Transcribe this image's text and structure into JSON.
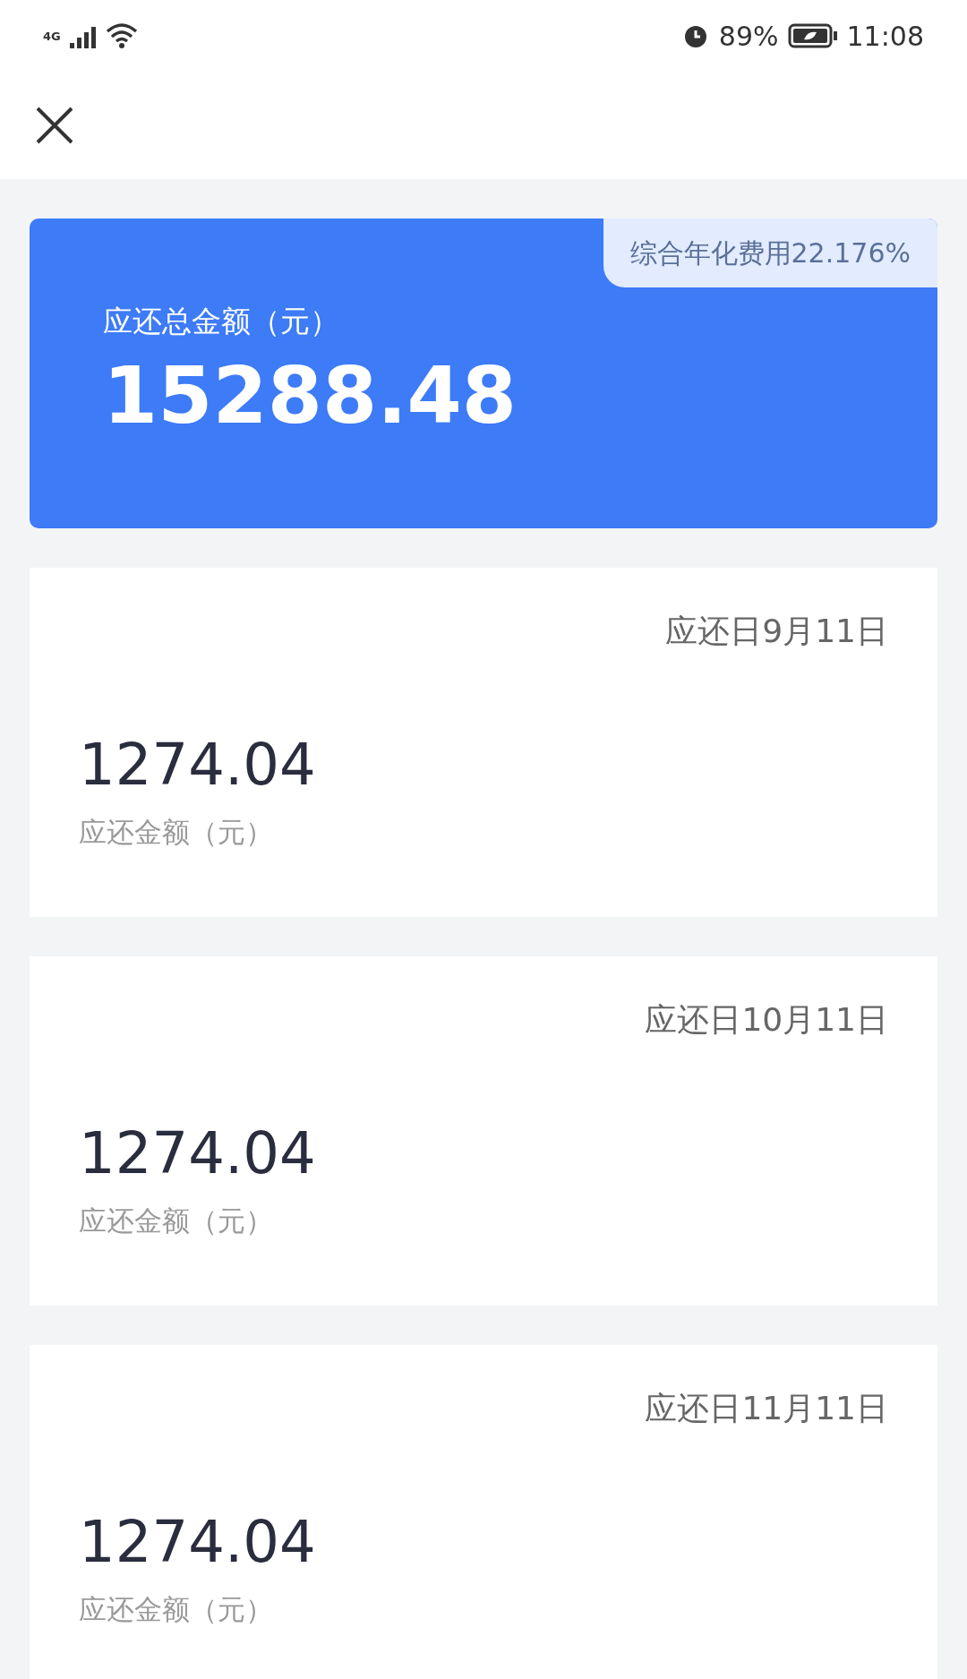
{
  "status_bar": {
    "network": "4G",
    "battery": "89%",
    "time": "11:08"
  },
  "summary": {
    "badge": "综合年化费用22.176%",
    "label": "应还总金额（元）",
    "amount": "15288.48"
  },
  "installments": [
    {
      "due": "应还日9月11日",
      "amount": "1274.04",
      "label": "应还金额（元）"
    },
    {
      "due": "应还日10月11日",
      "amount": "1274.04",
      "label": "应还金额（元）"
    },
    {
      "due": "应还日11月11日",
      "amount": "1274.04",
      "label": "应还金额（元）"
    }
  ]
}
